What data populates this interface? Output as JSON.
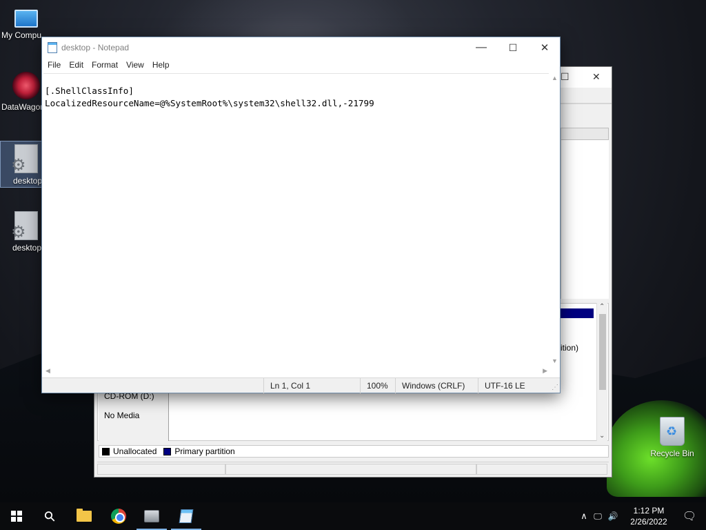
{
  "desktop": {
    "icons": [
      {
        "label": "My Compu"
      },
      {
        "label": "DataWagon"
      },
      {
        "label": "desktop"
      },
      {
        "label": "desktop"
      },
      {
        "label": "Recycle Bin"
      }
    ]
  },
  "disk_management": {
    "close_glyph": "✕",
    "maximize_glyph": "☐",
    "partition_fragment": "ition)",
    "cdrom_label": "CD-ROM (D:)",
    "cdrom_status": "No Media",
    "legend": [
      {
        "label": "Unallocated",
        "color": "#000000"
      },
      {
        "label": "Primary partition",
        "color": "#000080"
      }
    ]
  },
  "notepad": {
    "title": "desktop - Notepad",
    "menu": [
      "File",
      "Edit",
      "Format",
      "View",
      "Help"
    ],
    "content_lines": [
      "[.ShellClassInfo]",
      "LocalizedResourceName=@%SystemRoot%\\system32\\shell32.dll,-21799"
    ],
    "status": {
      "position": "Ln 1, Col 1",
      "zoom": "100%",
      "line_ending": "Windows (CRLF)",
      "encoding": "UTF-16 LE"
    },
    "buttons": {
      "minimize": "—",
      "maximize": "☐",
      "close": "✕"
    }
  },
  "taskbar": {
    "clock_time": "1:12 PM",
    "clock_date": "2/26/2022",
    "tray_chevron": "∧",
    "tray_network": "🖵",
    "tray_volume": "🔊",
    "notification": "🗨",
    "search_glyph": "⚲"
  }
}
